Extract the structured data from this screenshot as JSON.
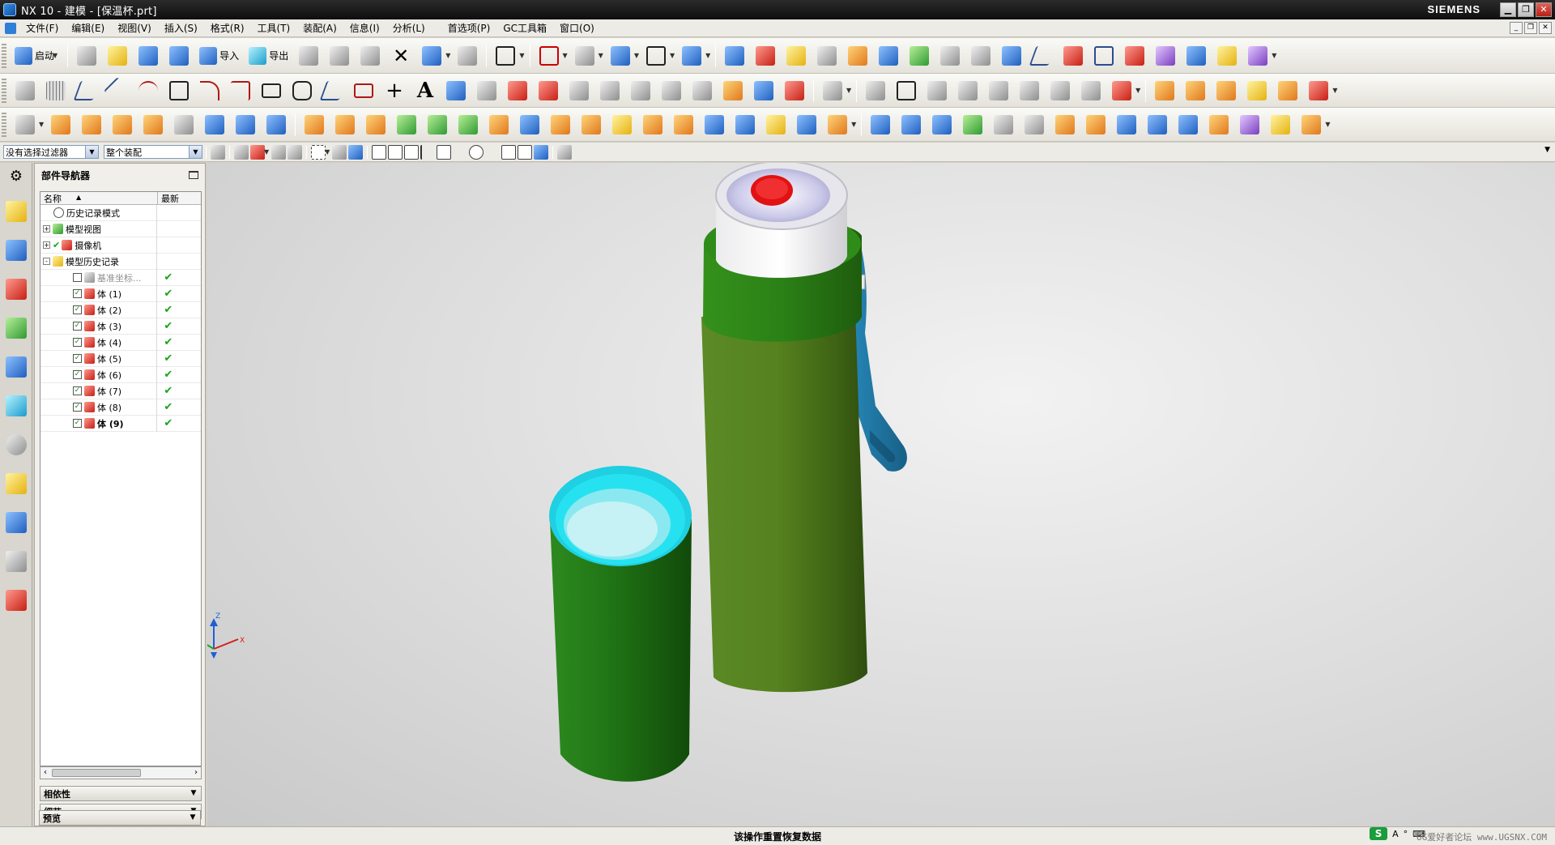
{
  "window": {
    "title": "NX 10 - 建模 - [保温杯.prt]",
    "brand": "SIEMENS"
  },
  "menu": {
    "items": [
      "文件(F)",
      "编辑(E)",
      "视图(V)",
      "插入(S)",
      "格式(R)",
      "工具(T)",
      "装配(A)",
      "信息(I)",
      "分析(L)",
      "首选项(P)",
      "GC工具箱",
      "窗口(O)"
    ]
  },
  "toolbar": {
    "start_label": "启动",
    "import_label": "导入",
    "export_label": "导出"
  },
  "selection_bar": {
    "filter_value": "没有选择过滤器",
    "scope_value": "整个装配"
  },
  "part_navigator": {
    "title": "部件导航器",
    "columns": {
      "name": "名称",
      "latest": "最新"
    },
    "nodes": [
      {
        "label": "历史记录模式",
        "level": 0,
        "icon": "clock-icon"
      },
      {
        "label": "模型视图",
        "level": 0,
        "expander": "+",
        "icon": "model-views-icon"
      },
      {
        "label": "摄像机",
        "level": 0,
        "expander": "+",
        "icon": "camera-icon"
      },
      {
        "label": "模型历史记录",
        "level": 0,
        "expander": "-",
        "icon": "folder-icon"
      }
    ],
    "features": [
      {
        "label": "基准坐标...",
        "checked": false,
        "latest": "✔",
        "dim": true
      },
      {
        "label": "体 (1)",
        "checked": true,
        "latest": "✔"
      },
      {
        "label": "体 (2)",
        "checked": true,
        "latest": "✔"
      },
      {
        "label": "体 (3)",
        "checked": true,
        "latest": "✔"
      },
      {
        "label": "体 (4)",
        "checked": true,
        "latest": "✔"
      },
      {
        "label": "体 (5)",
        "checked": true,
        "latest": "✔"
      },
      {
        "label": "体 (6)",
        "checked": true,
        "latest": "✔"
      },
      {
        "label": "体 (7)",
        "checked": true,
        "latest": "✔"
      },
      {
        "label": "体 (8)",
        "checked": true,
        "latest": "✔"
      },
      {
        "label": "体 (9)",
        "checked": true,
        "latest": "✔",
        "bold": true
      }
    ],
    "panels": [
      "相依性",
      "细节",
      "预览"
    ]
  },
  "triad": {
    "x": "X",
    "y": "Y",
    "z": "Z"
  },
  "status": {
    "message": "该操作重置恢复数据",
    "watermark": "UG爱好者论坛 www.UGSNX.COM"
  },
  "colors": {
    "bottle_body": "#4f7a1f",
    "bottle_ring": "#2b7d16",
    "cap_white": "#f1f1f3",
    "button_red": "#e01010",
    "strap_blue": "#1f7fae",
    "cup_outer": "#1f7a1a",
    "cup_rim": "#22d4e8"
  }
}
